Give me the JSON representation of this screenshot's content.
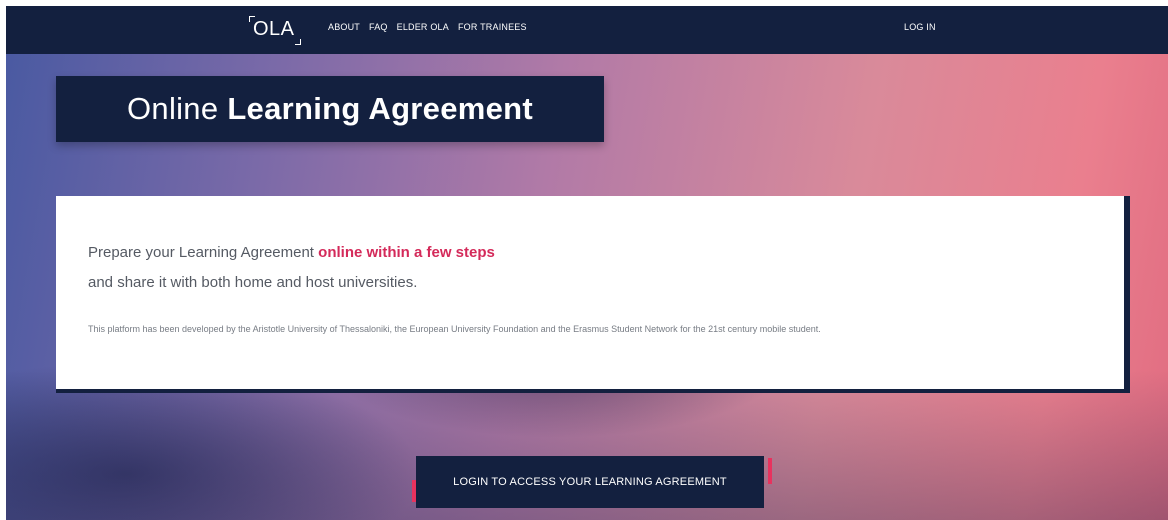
{
  "navbar": {
    "logo": "OLA",
    "links": [
      {
        "label": "ABOUT"
      },
      {
        "label": "FAQ"
      },
      {
        "label": "ELDER OLA"
      },
      {
        "label": "FOR TRAINEES"
      }
    ],
    "login_label": "LOG IN"
  },
  "hero": {
    "title_light": "Online ",
    "title_bold": "Learning Agreement"
  },
  "card": {
    "lead_part1": "Prepare your Learning Agreement ",
    "lead_accent": "online within a few steps",
    "lead_part2": "and share it with both home and host universities.",
    "fine_print": "This platform has been developed by the Aristotle University of Thessaloniki, the European University Foundation and the Erasmus Student Network for the 21st century mobile student."
  },
  "cta": {
    "label": "LOGIN TO ACCESS YOUR LEARNING AGREEMENT"
  },
  "colors": {
    "navy": "#13203f",
    "accent": "#d42a5a",
    "bracket": "#e8325e"
  }
}
